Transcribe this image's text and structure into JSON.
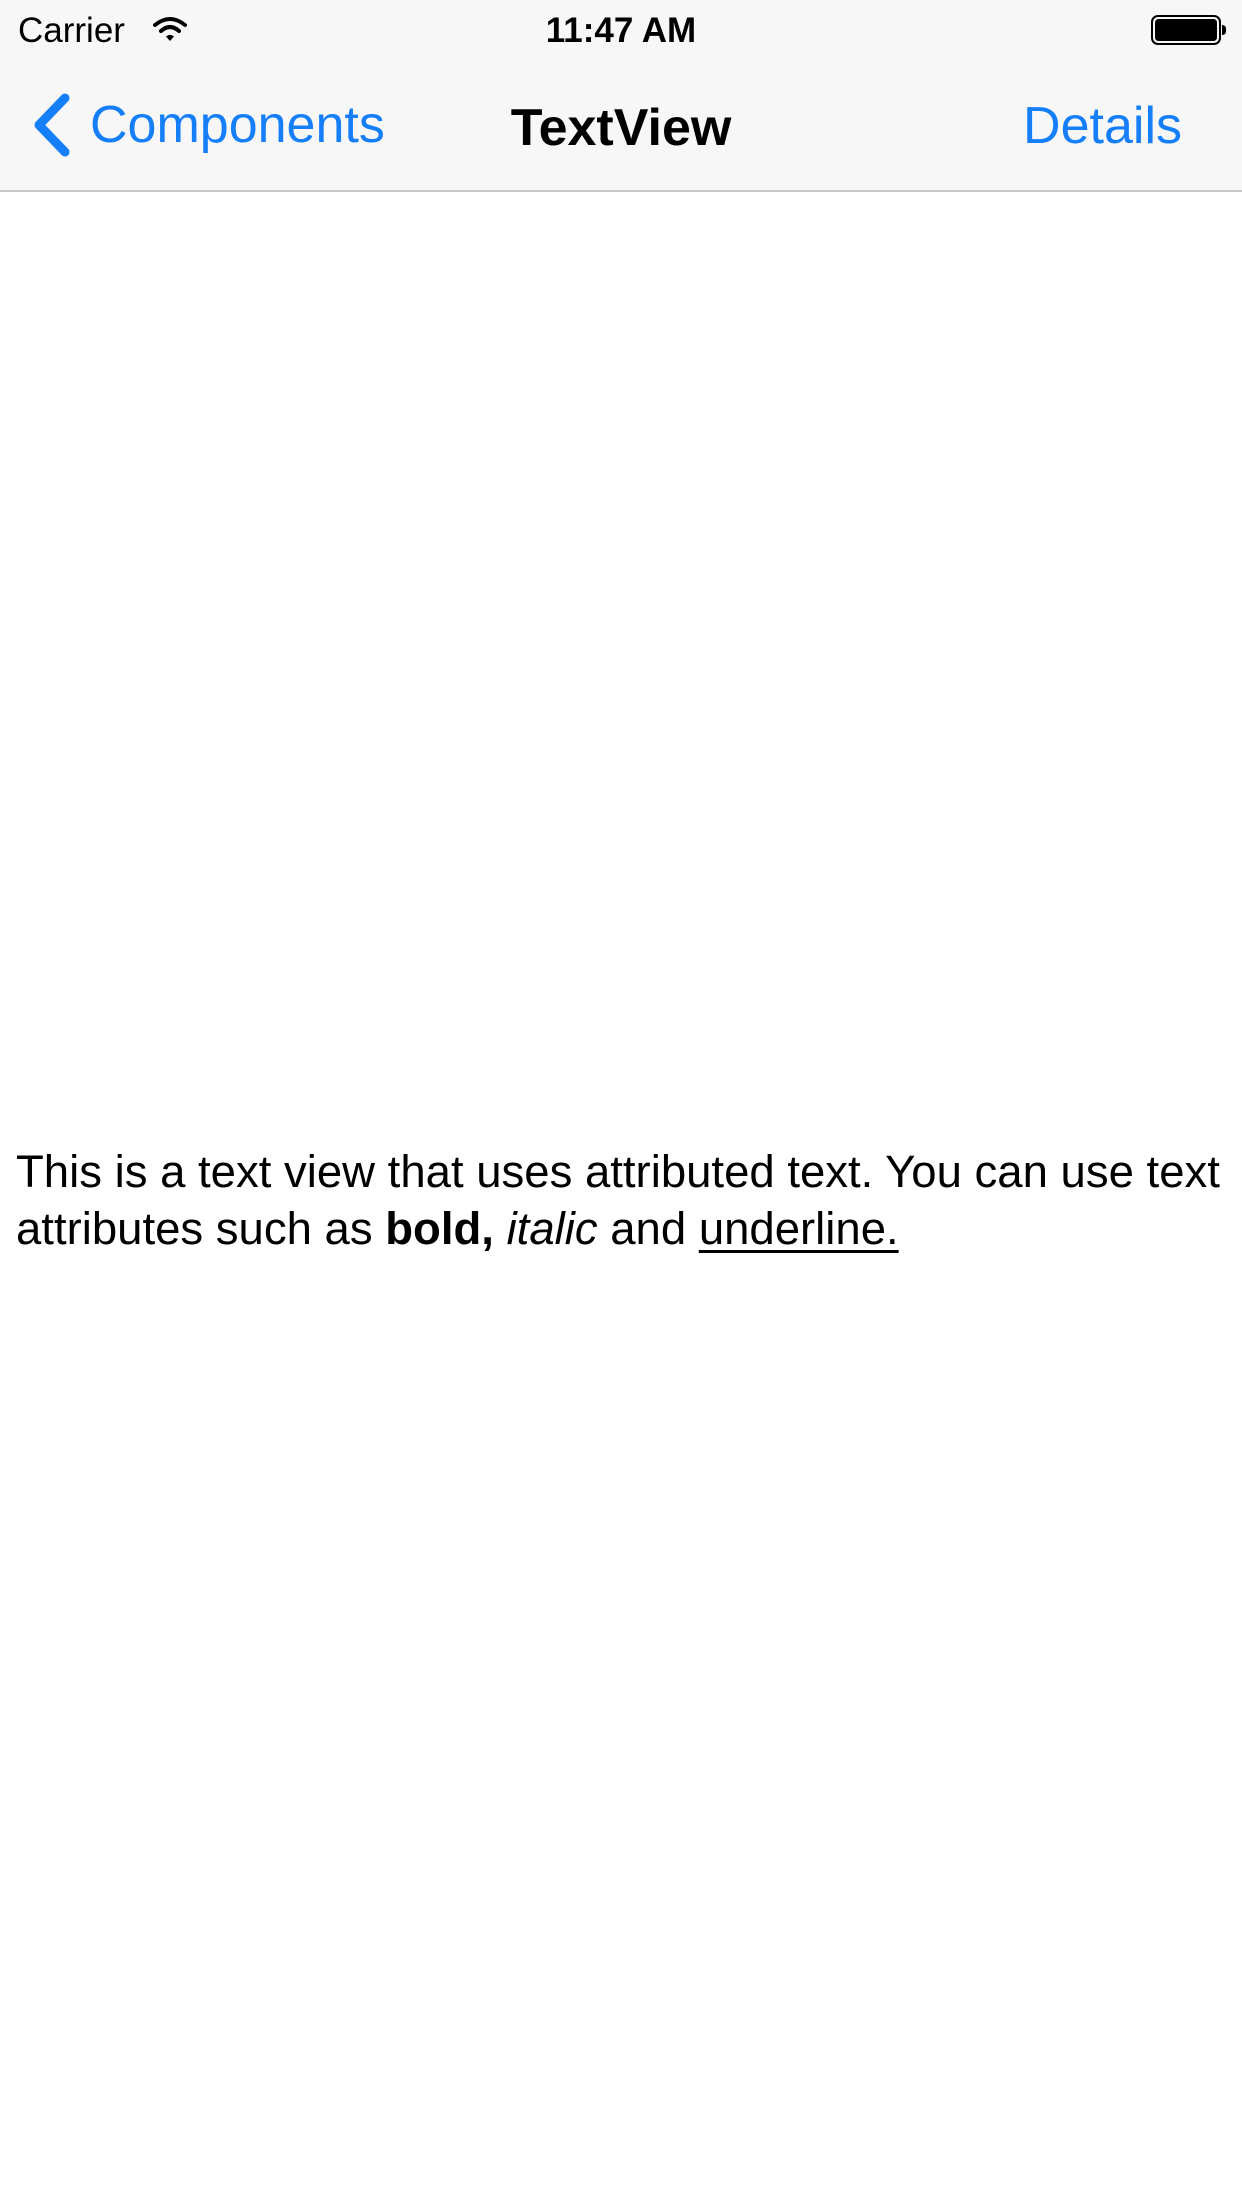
{
  "status_bar": {
    "carrier": "Carrier",
    "time": "11:47 AM",
    "icons": [
      "wifi-icon",
      "battery-icon"
    ]
  },
  "nav_bar": {
    "back_label": "Components",
    "title": "TextView",
    "right_button_label": "Details",
    "icons": [
      "chevron-left-icon"
    ]
  },
  "text_view": {
    "segments": [
      {
        "text": "This is a text view that uses attributed text. You can use text attributes such as ",
        "style": "normal"
      },
      {
        "text": "bold,",
        "style": "bold"
      },
      {
        "text": " ",
        "style": "normal"
      },
      {
        "text": "italic",
        "style": "italic"
      },
      {
        "text": " and ",
        "style": "normal"
      },
      {
        "text": "underline.",
        "style": "underline"
      }
    ]
  },
  "colors": {
    "tint": "#157efb",
    "bar_background": "#f7f7f8",
    "bar_separator": "#c8c8cc",
    "background": "#ffffff",
    "text": "#000000"
  }
}
